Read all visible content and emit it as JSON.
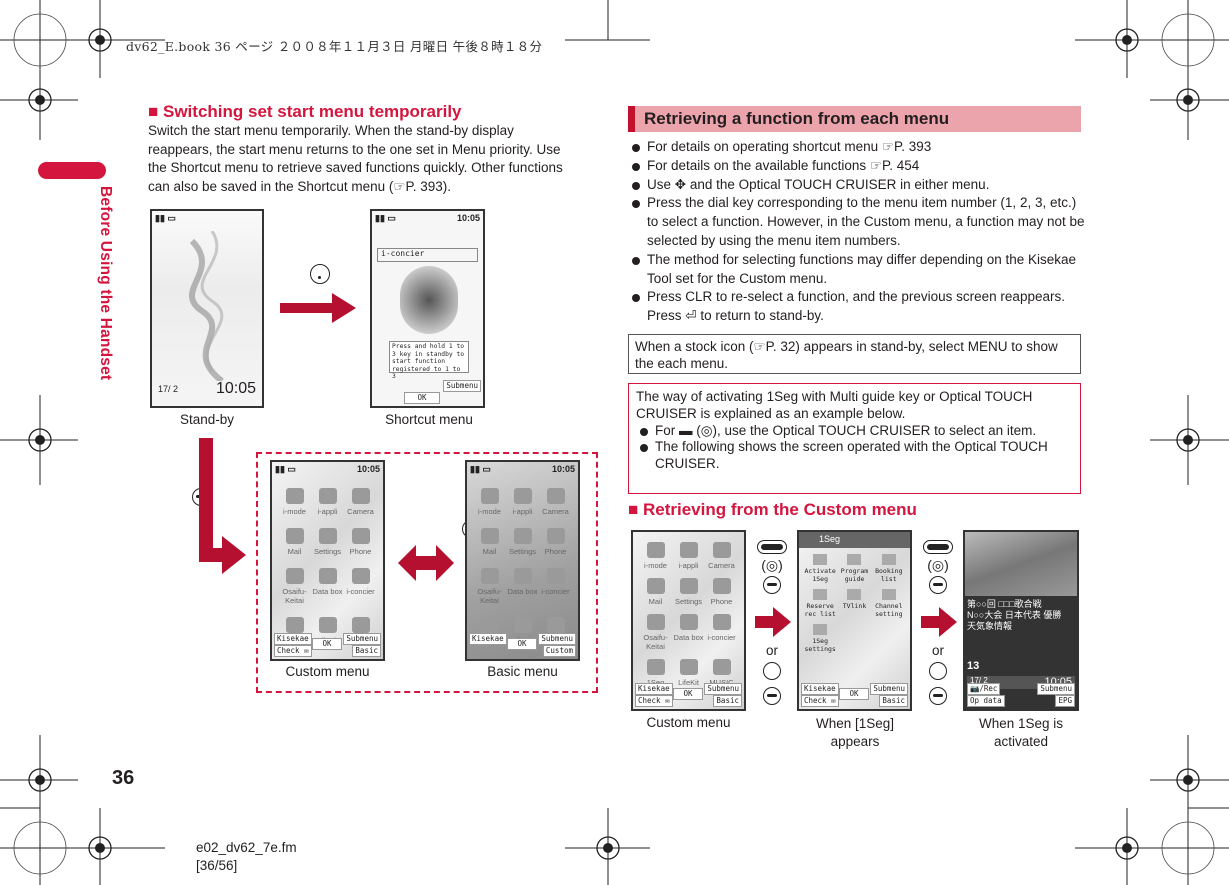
{
  "print_header": "dv62_E.book  36 ページ  ２００８年１１月３日  月曜日  午後８時１８分",
  "side_tab": "Before Using the Handset",
  "page_number": "36",
  "footer": {
    "file": "e02_dv62_7e.fm",
    "pages": "[36/56]"
  },
  "accent_color": "#d4163f",
  "left": {
    "heading": "■ Switching set start menu temporarily",
    "paragraph": "Switch the start menu temporarily. When the stand-by display reappears, the start menu returns to the one set in Menu priority. Use the Shortcut menu to retrieve saved functions quickly. Other functions can also be saved in the Shortcut menu (☞P. 393).",
    "standby": {
      "caption": "Stand-by",
      "time": "10:05",
      "date": "17/ 2"
    },
    "shortcut": {
      "caption": "Shortcut menu",
      "title": "i-concier",
      "time": "10:05",
      "hint": "Press and hold 1 to 3 key in standby to start function registered to 1 to 3",
      "ok": "OK",
      "submenu": "Submenu"
    },
    "custom": {
      "caption": "Custom menu"
    },
    "basic": {
      "caption": "Basic menu"
    },
    "menu_items": [
      "i-mode",
      "i-appli",
      "Camera",
      "Mail",
      "Settings",
      "Phone",
      "Osaifu-Keitai",
      "Data box",
      "i-concier",
      "1Seg",
      "LifeKit",
      "MUSIC"
    ],
    "softkeys_custom": {
      "kisekae": "Kisekae",
      "check": "Check ✉",
      "ok": "OK",
      "submenu": "Submenu",
      "mode": "Basic"
    },
    "softkeys_basic": {
      "kisekae": "Kisekae",
      "ok": "OK",
      "submenu": "Submenu",
      "mode": "Custom"
    },
    "time": "10:05"
  },
  "right": {
    "heading": "Retrieving a function from each menu",
    "bullets": [
      "For details on operating shortcut menu ☞P. 393",
      "For details on the available functions ☞P. 454",
      "Use ✥ and the Optical TOUCH CRUISER in either menu.",
      "Press the dial key corresponding to the menu item number (1, 2, 3, etc.) to select a function. However, in the Custom menu, a function may not be selected by using the menu item numbers.",
      "The method for selecting functions may differ depending on the Kisekae Tool set for the Custom menu.",
      "Press CLR to re-select a function, and the previous screen reappears. Press ⏎ to return to stand-by."
    ],
    "note_box": "When a stock icon (☞P. 32) appears in stand-by, select MENU to show the each menu.",
    "example_box": {
      "intro": "The way of activating 1Seg with Multi guide key or Optical TOUCH CRUISER is explained as an example below.",
      "bullets": [
        "For ▬ (◎), use the Optical TOUCH CRUISER to select an item.",
        "The following shows the screen operated with the Optical TOUCH CRUISER."
      ]
    },
    "subheading": "■ Retrieving from the Custom menu",
    "or_label": "or",
    "screens": [
      {
        "caption": "Custom menu"
      },
      {
        "caption": "When [1Seg] appears",
        "title": "1Seg",
        "items": [
          "Activate 1Seg",
          "Program guide",
          "Booking list",
          "Reserve rec list",
          "TVlink",
          "Channel setting",
          "1Seg settings"
        ],
        "softkeys": {
          "kisekae": "Kisekae",
          "check": "Check ✉",
          "ok": "OK",
          "submenu": "Submenu",
          "mode": "Basic"
        }
      },
      {
        "caption": "When 1Seg is activated",
        "ticker": [
          "第○○回 □□□歌合戦",
          "N○○大会 日本代表 優勝",
          "天気象情報"
        ],
        "channel": "13",
        "date": "17/ 2",
        "time": "10:05",
        "softkeys": {
          "rec": "📷/Rec",
          "opdata": "Op data",
          "submenu": "Submenu",
          "epg": "EPG"
        }
      }
    ]
  }
}
